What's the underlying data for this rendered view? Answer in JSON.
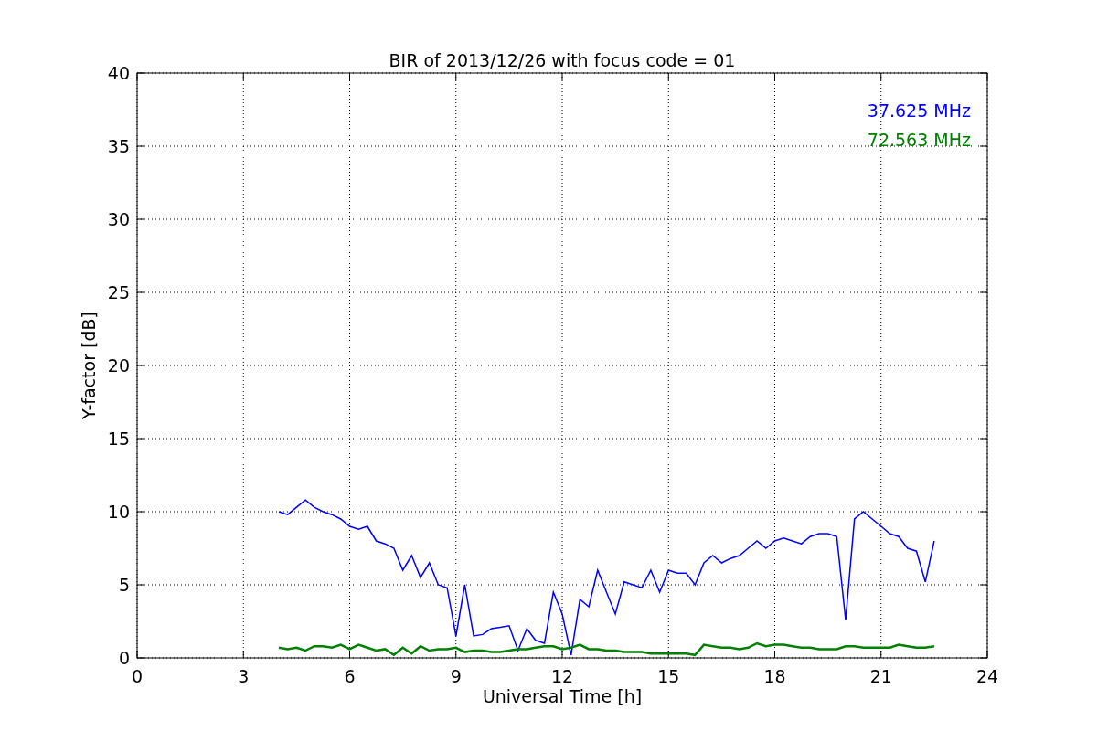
{
  "plot": {
    "chart_data": {
      "type": "line",
      "title": "BIR of 2013/12/26 with focus code = 01",
      "xlabel": "Universal Time [h]",
      "ylabel": "Y-factor [dB]",
      "grid": true,
      "xlim": [
        0,
        24
      ],
      "ylim": [
        0,
        40
      ],
      "xticks": [
        0,
        3,
        6,
        9,
        12,
        15,
        18,
        21,
        24
      ],
      "yticks": [
        0,
        5,
        10,
        15,
        20,
        25,
        30,
        35,
        40
      ],
      "x": [
        4.0,
        4.25,
        4.5,
        4.75,
        5.0,
        5.25,
        5.5,
        5.75,
        6.0,
        6.25,
        6.5,
        6.75,
        7.0,
        7.25,
        7.5,
        7.75,
        8.0,
        8.25,
        8.5,
        8.75,
        9.0,
        9.25,
        9.5,
        9.75,
        10.0,
        10.25,
        10.5,
        10.75,
        11.0,
        11.25,
        11.5,
        11.75,
        12.0,
        12.25,
        12.5,
        12.75,
        13.0,
        13.25,
        13.5,
        13.75,
        14.0,
        14.25,
        14.5,
        14.75,
        15.0,
        15.25,
        15.5,
        15.75,
        16.0,
        16.25,
        16.5,
        16.75,
        17.0,
        17.25,
        17.5,
        17.75,
        18.0,
        18.25,
        18.5,
        18.75,
        19.0,
        19.25,
        19.5,
        19.75,
        20.0,
        20.25,
        20.5,
        20.75,
        21.0,
        21.25,
        21.5,
        21.75,
        22.0,
        22.25,
        22.5
      ],
      "series": [
        {
          "name": "37.625 MHz",
          "color": "#0000ff",
          "values": [
            10,
            9.8,
            10.3,
            10.8,
            10.3,
            10,
            9.8,
            9.5,
            9.0,
            8.8,
            9.0,
            8.0,
            7.8,
            7.5,
            6.0,
            7.0,
            5.5,
            6.5,
            5.0,
            4.8,
            1.5,
            5.0,
            1.5,
            1.6,
            2.0,
            2.1,
            2.2,
            0.5,
            2.0,
            1.2,
            1.0,
            4.5,
            3.0,
            0.2,
            4.0,
            3.5,
            6.0,
            4.5,
            3.0,
            5.2,
            5.0,
            4.8,
            6.0,
            4.5,
            6.0,
            5.8,
            5.8,
            5.0,
            6.5,
            7.0,
            6.5,
            6.8,
            7.0,
            7.5,
            8.0,
            7.5,
            8.0,
            8.2,
            8.0,
            7.8,
            8.3,
            8.5,
            8.5,
            8.3,
            2.6,
            9.5,
            10.0,
            9.5,
            9.0,
            8.5,
            8.3,
            7.5,
            7.3,
            5.2,
            8.0
          ]
        },
        {
          "name": "72.563 MHz",
          "color": "#008000",
          "values": [
            0.7,
            0.6,
            0.7,
            0.5,
            0.8,
            0.8,
            0.7,
            0.9,
            0.6,
            0.9,
            0.7,
            0.5,
            0.6,
            0.2,
            0.7,
            0.3,
            0.8,
            0.5,
            0.6,
            0.6,
            0.7,
            0.4,
            0.5,
            0.5,
            0.4,
            0.4,
            0.5,
            0.6,
            0.6,
            0.7,
            0.8,
            0.8,
            0.6,
            0.7,
            0.9,
            0.6,
            0.6,
            0.5,
            0.5,
            0.4,
            0.4,
            0.4,
            0.3,
            0.3,
            0.3,
            0.3,
            0.3,
            0.2,
            0.9,
            0.8,
            0.7,
            0.7,
            0.6,
            0.7,
            1.0,
            0.8,
            0.9,
            0.9,
            0.8,
            0.7,
            0.7,
            0.6,
            0.6,
            0.6,
            0.8,
            0.8,
            0.7,
            0.7,
            0.7,
            0.7,
            0.9,
            0.8,
            0.7,
            0.7,
            0.8
          ]
        }
      ]
    }
  }
}
